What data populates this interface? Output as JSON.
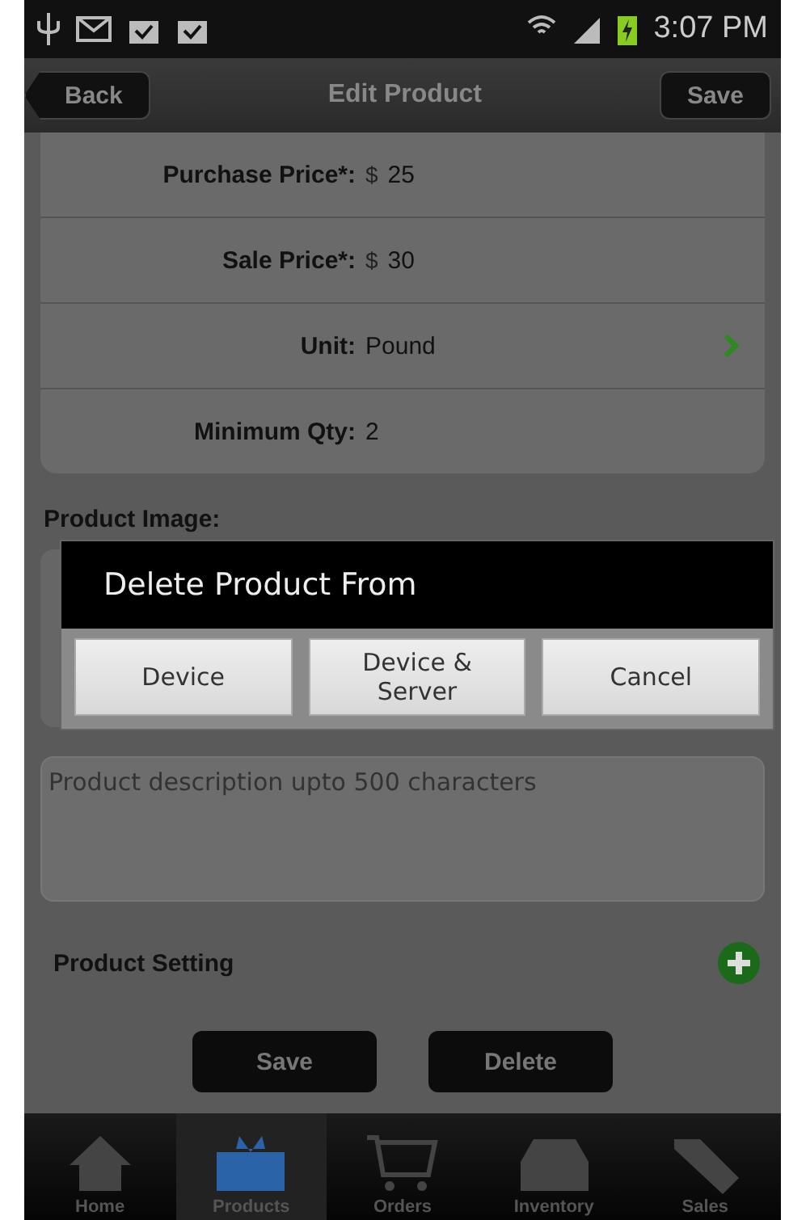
{
  "status_bar": {
    "time": "3:07 PM"
  },
  "nav_bar": {
    "back": "Back",
    "title": "Edit Product",
    "save": "Save"
  },
  "fields": [
    {
      "kind": "currency",
      "label": "Purchase Price*:",
      "symbol": "$",
      "value": "25"
    },
    {
      "kind": "currency",
      "label": "Sale Price*:",
      "symbol": "$",
      "value": "30"
    },
    {
      "kind": "picker",
      "label": "Unit:",
      "value": "Pound"
    },
    {
      "kind": "plain",
      "label": "Minimum Qty:",
      "value": "2"
    }
  ],
  "product_image": {
    "label": "Product Image:"
  },
  "description": {
    "placeholder": "Product description upto 500 characters"
  },
  "product_setting": {
    "label": "Product Setting"
  },
  "actions": [
    "Save",
    "Delete"
  ],
  "dialog": {
    "title": "Delete Product From",
    "buttons": [
      "Device",
      "Device &\nServer",
      "Cancel"
    ]
  },
  "tabs": [
    {
      "label": "Home",
      "selected": false
    },
    {
      "label": "Products",
      "selected": true
    },
    {
      "label": "Orders",
      "selected": false
    },
    {
      "label": "Inventory",
      "selected": false
    },
    {
      "label": "Sales",
      "selected": false
    }
  ]
}
